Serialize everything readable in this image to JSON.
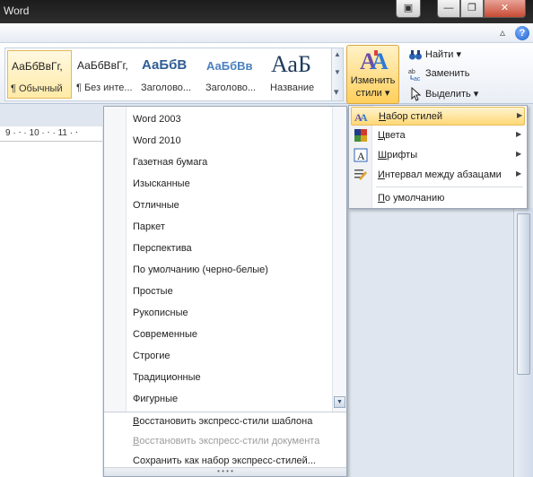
{
  "app": {
    "title": "Word"
  },
  "window_controls": {
    "custom": "▣",
    "minimize": "—",
    "maximize": "❐",
    "close": "✕"
  },
  "ribbon_top": {
    "caret": "▵",
    "help": "?"
  },
  "styles_gallery": {
    "tiles": [
      {
        "sample": "АаБбВвГг,",
        "label": "¶ Обычный",
        "selected": true
      },
      {
        "sample": "АаБбВвГг,",
        "label": "¶ Без инте..."
      },
      {
        "sample": "АаБбВ",
        "label": "Заголово..."
      },
      {
        "sample": "АаБбВв",
        "label": "Заголово..."
      },
      {
        "sample": "АаБ",
        "label": "Название"
      }
    ],
    "scroll": {
      "up": "▲",
      "down": "▼",
      "more": "▾"
    }
  },
  "change_styles": {
    "label_line1": "Изменить",
    "label_line2": "стили ▾"
  },
  "editing": {
    "find": {
      "icon": "binoculars-icon",
      "label": "Найти ▾"
    },
    "replace": {
      "icon": "replace-icon",
      "label": "Заменить"
    },
    "select": {
      "icon": "cursor-icon",
      "label": "Выделить ▾"
    }
  },
  "ruler": {
    "text": "9 · ⋅ · 10 · ⋅ · 11 · ⋅"
  },
  "style_sets": {
    "items": [
      "Word 2003",
      "Word 2010",
      "Газетная бумага",
      "Изысканные",
      "Отличные",
      "Паркет",
      "Перспектива",
      "По умолчанию (черно-белые)",
      "Простые",
      "Рукописные",
      "Современные",
      "Строгие",
      "Традиционные",
      "Фигурные"
    ],
    "actions": [
      {
        "label": "Восстановить экспресс-стили шаблона",
        "disabled": false
      },
      {
        "label": "Восстановить экспресс-стили документа",
        "disabled": true
      },
      {
        "label": "Сохранить как набор экспресс-стилей...",
        "disabled": false
      }
    ],
    "scroll_down": "▼",
    "grip": "• • • •"
  },
  "change_styles_menu": {
    "items": [
      {
        "label": "Набор стилей",
        "icon": "style-set-icon",
        "submenu": true,
        "highlighted": true
      },
      {
        "label": "Цвета",
        "icon": "colors-icon",
        "submenu": true
      },
      {
        "label": "Шрифты",
        "icon": "fonts-icon",
        "submenu": true
      },
      {
        "label": "Интервал между абзацами",
        "icon": "paragraph-spacing-icon",
        "submenu": true
      },
      {
        "label": "По умолчанию",
        "icon": "",
        "submenu": false
      }
    ],
    "submenu_arrow": "▶"
  },
  "colors": {
    "accent_highlight": "#ffd876",
    "menu_border": "#9aa7b8",
    "disabled_text": "#9c9c9c"
  }
}
